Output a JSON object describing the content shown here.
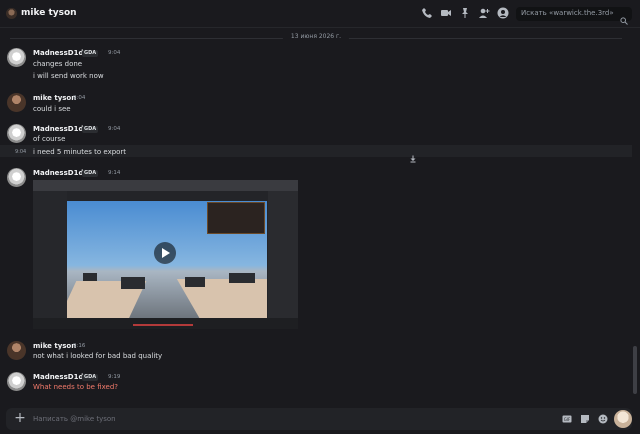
{
  "header": {
    "title": "mike tyson",
    "search_placeholder": "Искать «warwick.the.3rd»",
    "icons": [
      "phone-icon",
      "video-call-icon",
      "pin-icon",
      "add-member-icon",
      "profile-icon",
      "search-icon"
    ]
  },
  "date_divider": "13 июня 2026 г.",
  "messages": [
    {
      "author": "MadnessD1de",
      "tag": "GDA",
      "time": "9:04",
      "lines": [
        "changes done",
        "i will send work now"
      ]
    },
    {
      "author": "mike tyson",
      "time": "9:04",
      "lines": [
        "could i see"
      ]
    },
    {
      "author": "MadnessD1de",
      "tag": "GDA",
      "time": "9:04",
      "lines": [
        "of course"
      ]
    },
    {
      "hover_time": "9:04",
      "lines": [
        "i need 5 minutes to export"
      ]
    },
    {
      "author": "MadnessD1de",
      "tag": "GDA",
      "time": "9:14",
      "attachment": "video"
    },
    {
      "author": "mike tyson",
      "time": "9:16",
      "lines": [
        "not what i looked for bad bad quality"
      ]
    },
    {
      "author": "MadnessD1de",
      "tag": "GDA",
      "time": "9:19",
      "lines": [
        "What needs to be fixed?"
      ]
    }
  ],
  "composer": {
    "placeholder": "Написать @mike tyson",
    "icons": [
      "plus-icon",
      "gif-icon",
      "sticker-icon",
      "emoji-icon"
    ]
  },
  "colors": {
    "background": "#1a1a1e",
    "red_text": "#f27a6b",
    "muted": "#949ba4"
  }
}
